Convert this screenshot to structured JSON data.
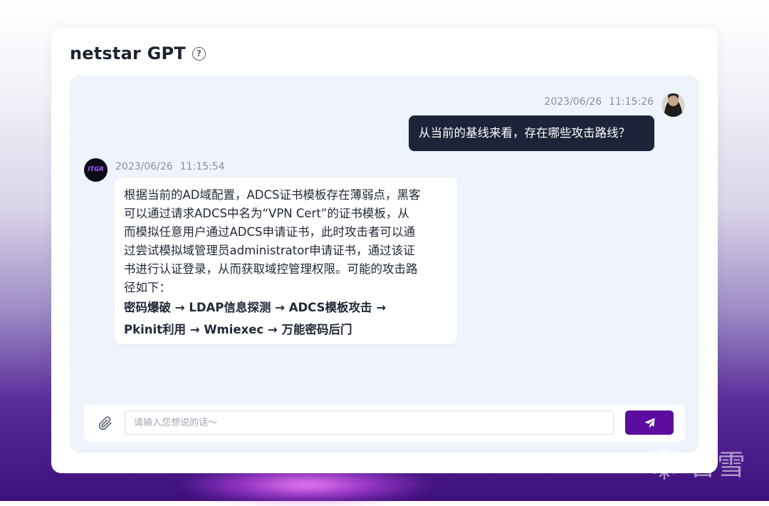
{
  "app": {
    "title": "netstar GPT",
    "help_icon": "question-circle-icon"
  },
  "messages": [
    {
      "role": "user",
      "date": "2023/06/26",
      "time": "11:15:26",
      "text": "从当前的基线来看，存在哪些攻击路线？"
    },
    {
      "role": "assistant",
      "date": "2023/06/26",
      "time": "11:15:54",
      "avatar_text": "ITGR",
      "lines": [
        "根据当前的AD域配置，ADCS证书模板存在薄弱点，黑客",
        "可以通过请求ADCS中名为“VPN Cert”的证书模板，从",
        "而模拟任意用户通过ADCS申请证书，此时攻击者可以通",
        "过尝试模拟域管理员administrator申请证书，通过该证",
        "书进行认证登录，从而获取域控管理权限。可能的攻击路",
        "径如下："
      ],
      "path_lines": [
        "密码爆破 → LDAP信息探测 → ADCS模板攻击 →",
        "Pkinit利用 → Wmiexec → 万能密码后门"
      ]
    }
  ],
  "input": {
    "placeholder": "请输入您想说的话～",
    "value": ""
  },
  "icons": {
    "attach": "paperclip-icon",
    "send": "send-icon"
  },
  "watermark": {
    "text": "看雪"
  },
  "colors": {
    "user_bubble": "#1b2438",
    "send_button": "#5c0da0",
    "chat_panel": "#eef3fc"
  }
}
